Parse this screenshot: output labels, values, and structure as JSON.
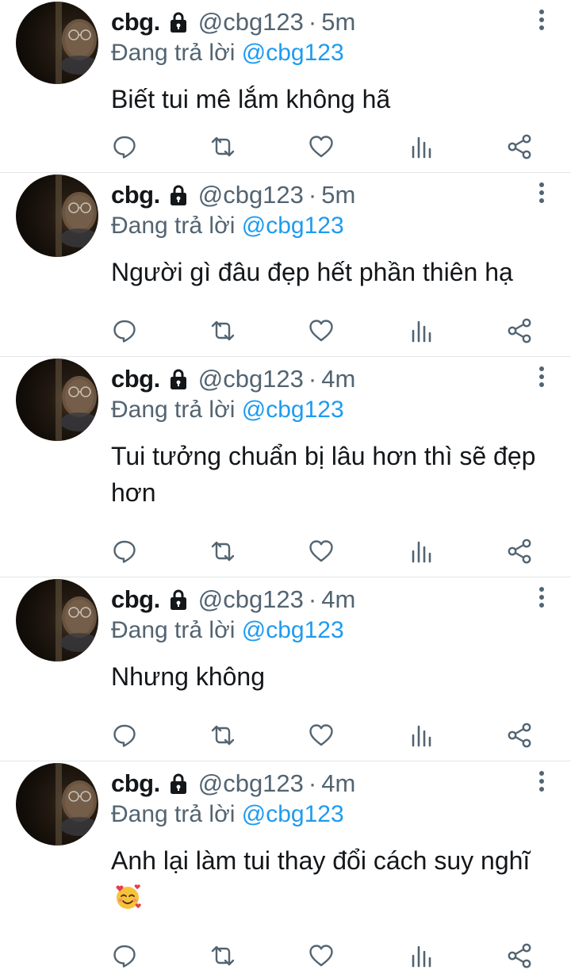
{
  "accent_color": "#1d9bf0",
  "muted_color": "#536471",
  "tweets": [
    {
      "name": "cbg.",
      "handle": "@cbg123",
      "separator": "·",
      "time": "5m",
      "reply_prefix": "Đang trả lời",
      "reply_to": "@cbg123",
      "text": "Biết tui mê lắm không hã",
      "emoji": ""
    },
    {
      "name": "cbg.",
      "handle": "@cbg123",
      "separator": "·",
      "time": "5m",
      "reply_prefix": "Đang trả lời",
      "reply_to": "@cbg123",
      "text": "Người gì đâu đẹp hết phần thiên hạ",
      "emoji": ""
    },
    {
      "name": "cbg.",
      "handle": "@cbg123",
      "separator": "·",
      "time": "4m",
      "reply_prefix": "Đang trả lời",
      "reply_to": "@cbg123",
      "text": "Tui tưởng chuẩn bị lâu hơn thì sẽ đẹp hơn",
      "emoji": ""
    },
    {
      "name": "cbg.",
      "handle": "@cbg123",
      "separator": "·",
      "time": "4m",
      "reply_prefix": "Đang trả lời",
      "reply_to": "@cbg123",
      "text": "Nhưng không",
      "emoji": ""
    },
    {
      "name": "cbg.",
      "handle": "@cbg123",
      "separator": "·",
      "time": "4m",
      "reply_prefix": "Đang trả lời",
      "reply_to": "@cbg123",
      "text": "Anh lại làm tui thay đổi cách suy nghĩ",
      "emoji": "smiling-face-with-hearts-emoji"
    }
  ],
  "icons": {
    "lock": "lock-icon",
    "more": "more-vertical-icon",
    "reply": "reply-icon",
    "retweet": "retweet-icon",
    "like": "heart-icon",
    "views": "views-icon",
    "share": "share-icon"
  }
}
